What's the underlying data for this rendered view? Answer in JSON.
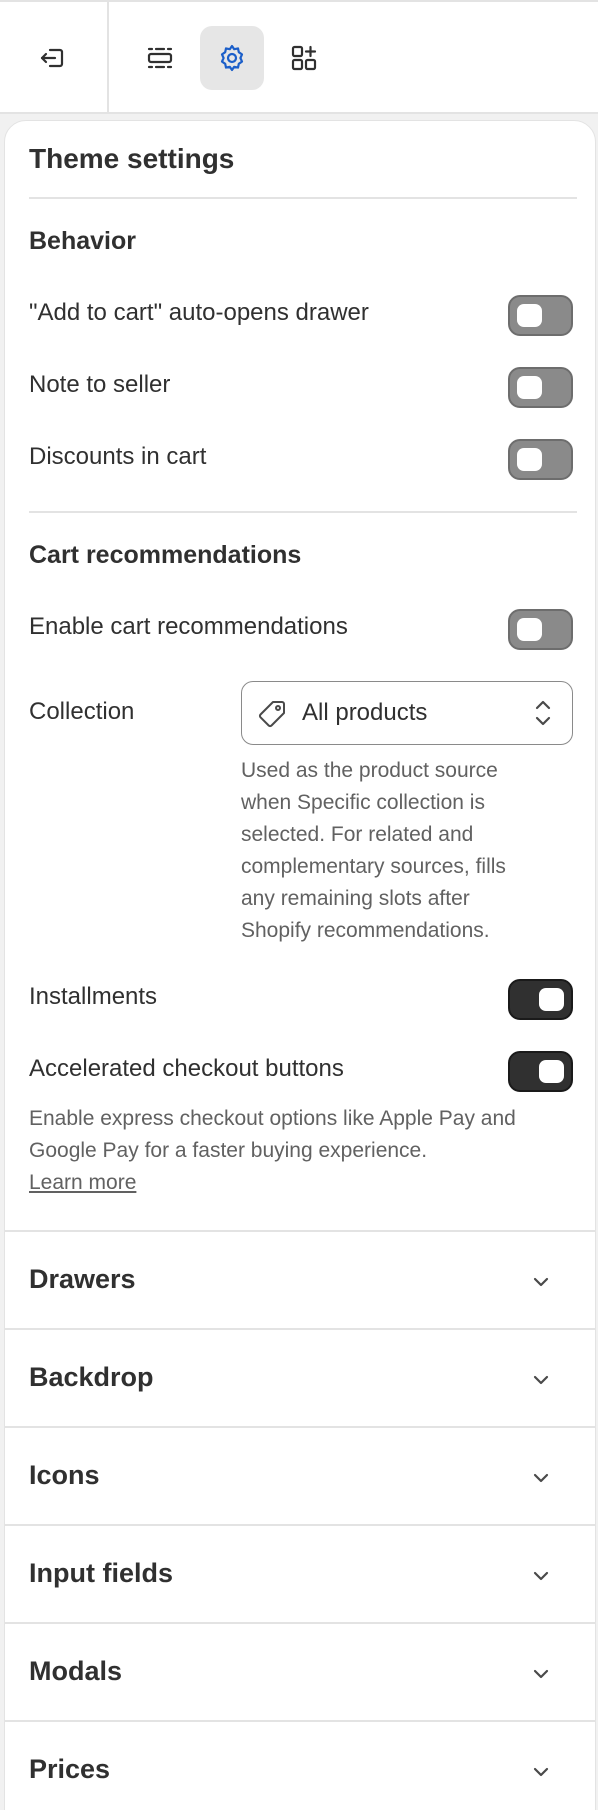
{
  "toolbar": {
    "buttons": [
      {
        "name": "exit",
        "icon": "exit-icon"
      },
      {
        "name": "sections",
        "icon": "sections-icon"
      },
      {
        "name": "theme-settings",
        "icon": "gear-icon",
        "active": true
      },
      {
        "name": "apps",
        "icon": "apps-icon"
      }
    ],
    "accent_color": "#1c5fc9"
  },
  "panel": {
    "title": "Theme settings",
    "behavior": {
      "title": "Behavior",
      "items": [
        {
          "label": "\"Add to cart\" auto-opens drawer",
          "enabled": false
        },
        {
          "label": "Note to seller",
          "enabled": false
        },
        {
          "label": "Discounts in cart",
          "enabled": false
        }
      ]
    },
    "cart_recommendations": {
      "title": "Cart recommendations",
      "enable_label": "Enable cart recommendations",
      "enable_on": false,
      "collection_label": "Collection",
      "collection_value": "All products",
      "collection_icon": "tag-icon",
      "collection_help_lines": [
        "Used as the product source",
        "when Specific collection is",
        "selected. For related and",
        "complementary sources, fills",
        "any remaining slots after",
        "Shopify recommendations."
      ],
      "installments_label": "Installments",
      "installments_on": true,
      "accelerated_label": "Accelerated checkout buttons",
      "accelerated_on": true,
      "accelerated_help_lines": [
        "Enable express checkout options like Apple Pay and",
        "Google Pay for a faster buying experience."
      ],
      "learn_more": "Learn more"
    },
    "accordions": [
      {
        "title": "Drawers"
      },
      {
        "title": "Backdrop"
      },
      {
        "title": "Icons"
      },
      {
        "title": "Input fields"
      },
      {
        "title": "Modals"
      },
      {
        "title": "Prices"
      }
    ]
  }
}
